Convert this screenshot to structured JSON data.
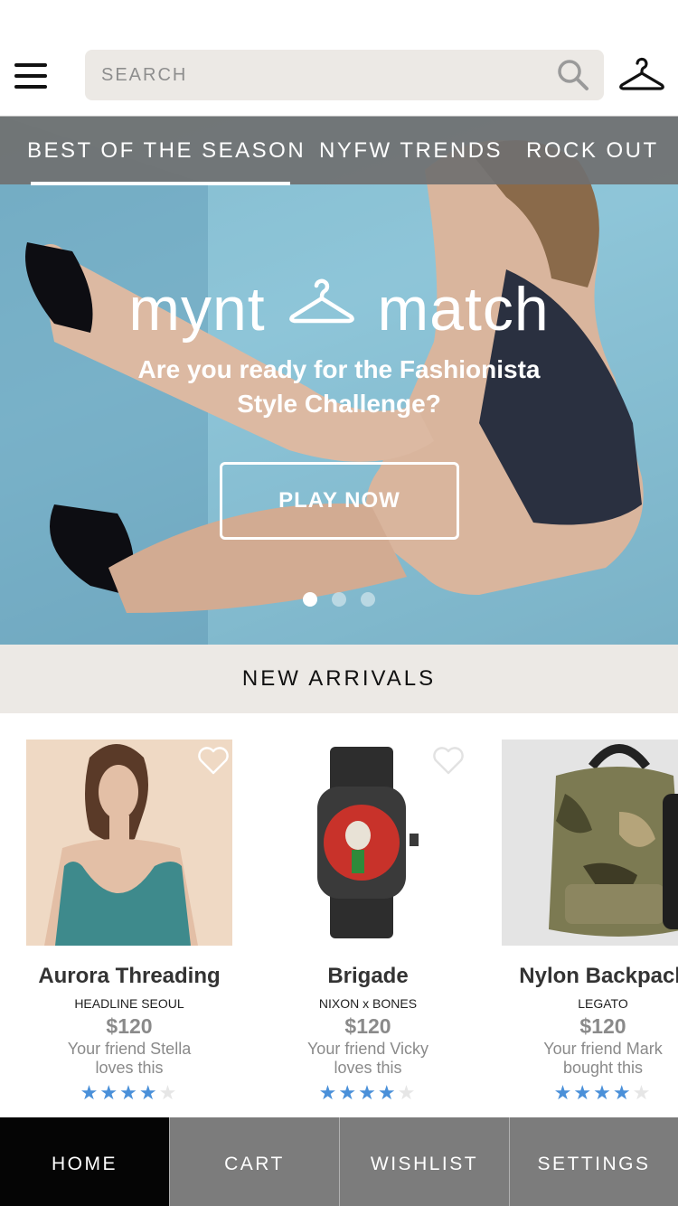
{
  "header": {
    "search_placeholder": "SEARCH",
    "icons": [
      "hamburger-menu-icon",
      "search-icon",
      "hanger-icon"
    ]
  },
  "tabs": [
    {
      "label": "BEST OF THE SEASON",
      "active": true
    },
    {
      "label": "NYFW TRENDS",
      "active": false
    },
    {
      "label": "ROCK OUT",
      "active": false
    }
  ],
  "hero": {
    "logo_left": "mynt",
    "logo_right": "match",
    "tagline": "Are you ready for the Fashionista Style Challenge?",
    "cta_label": "PLAY NOW",
    "slides_total": 3,
    "active_slide": 1
  },
  "section": {
    "title": "NEW ARRIVALS"
  },
  "products": [
    {
      "name": "Aurora Threading",
      "brand": "HEADLINE SEOUL",
      "price": "$120",
      "social": "Your friend Stella loves this",
      "rating": 4,
      "rating_max": 5
    },
    {
      "name": "Brigade",
      "brand": "NIXON x BONES",
      "price": "$120",
      "social": "Your friend Vicky loves this",
      "rating": 4,
      "rating_max": 5
    },
    {
      "name": "Nylon Backpack",
      "brand": "LEGATO",
      "price": "$120",
      "social": "Your friend Mark bought this",
      "rating": 4,
      "rating_max": 5
    }
  ],
  "bottom_nav": [
    {
      "label": "HOME",
      "active": true
    },
    {
      "label": "CART",
      "active": false
    },
    {
      "label": "WISHLIST",
      "active": false
    },
    {
      "label": "SETTINGS",
      "active": false
    }
  ],
  "colors": {
    "accent_star": "#4a90d9",
    "nav_active": "#050505",
    "nav_bg": "#7c7c7c",
    "search_bg": "#ece9e5"
  }
}
